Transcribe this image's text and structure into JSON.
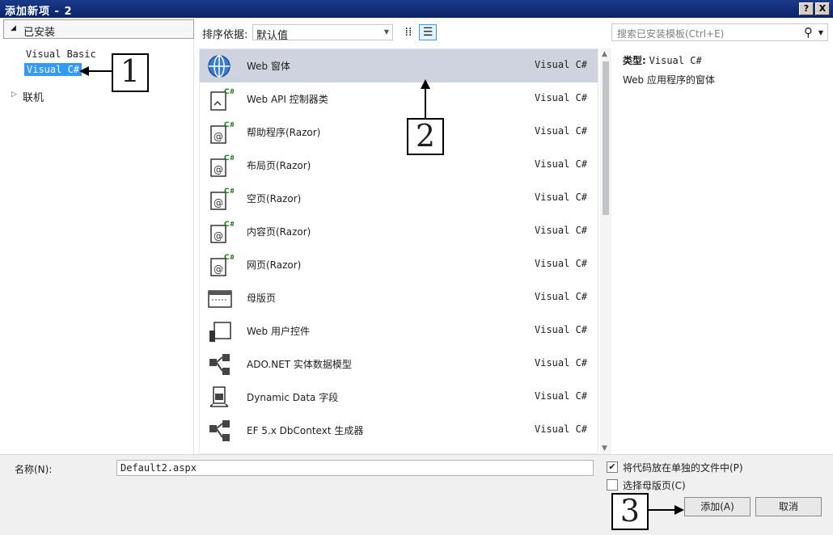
{
  "window": {
    "title": "添加新项 - 2",
    "help_label": "?",
    "close_label": "X"
  },
  "left_panel": {
    "installed_label": "已安装",
    "tree_items": [
      "Visual Basic",
      "Visual C#"
    ],
    "online_label": "联机"
  },
  "toolbar": {
    "sort_label": "排序依据:",
    "sort_value": "默认值"
  },
  "search": {
    "placeholder": "搜索已安装模板(Ctrl+E)"
  },
  "templates": [
    {
      "name": "Web 窗体",
      "lang": "Visual C#",
      "icon": "globe-icon",
      "selected": true
    },
    {
      "name": "Web API 控制器类",
      "lang": "Visual C#",
      "icon": "webapi-controller-icon"
    },
    {
      "name": "帮助程序(Razor)",
      "lang": "Visual C#",
      "icon": "razor-page-icon"
    },
    {
      "name": "布局页(Razor)",
      "lang": "Visual C#",
      "icon": "razor-page-icon"
    },
    {
      "name": "空页(Razor)",
      "lang": "Visual C#",
      "icon": "razor-page-icon"
    },
    {
      "name": "内容页(Razor)",
      "lang": "Visual C#",
      "icon": "razor-page-icon"
    },
    {
      "name": "网页(Razor)",
      "lang": "Visual C#",
      "icon": "razor-page-icon"
    },
    {
      "name": "母版页",
      "lang": "Visual C#",
      "icon": "master-page-icon"
    },
    {
      "name": "Web 用户控件",
      "lang": "Visual C#",
      "icon": "user-control-icon"
    },
    {
      "name": "ADO.NET 实体数据模型",
      "lang": "Visual C#",
      "icon": "entity-model-icon"
    },
    {
      "name": "Dynamic Data 字段",
      "lang": "Visual C#",
      "icon": "dynamic-data-icon"
    },
    {
      "name": "EF 5.x DbContext 生成器",
      "lang": "Visual C#",
      "icon": "entity-model-icon"
    }
  ],
  "detail": {
    "type_label": "类型:",
    "type_value": "Visual C#",
    "description": "Web 应用程序的窗体"
  },
  "bottom": {
    "name_label": "名称(N):",
    "name_value": "Default2.aspx",
    "separate_file_label": "将代码放在单独的文件中(P)",
    "separate_file_checked": true,
    "master_page_label": "选择母版页(C)",
    "master_page_checked": false,
    "add_button": "添加(A)",
    "cancel_button": "取消"
  },
  "callouts": [
    "1",
    "2",
    "3"
  ]
}
